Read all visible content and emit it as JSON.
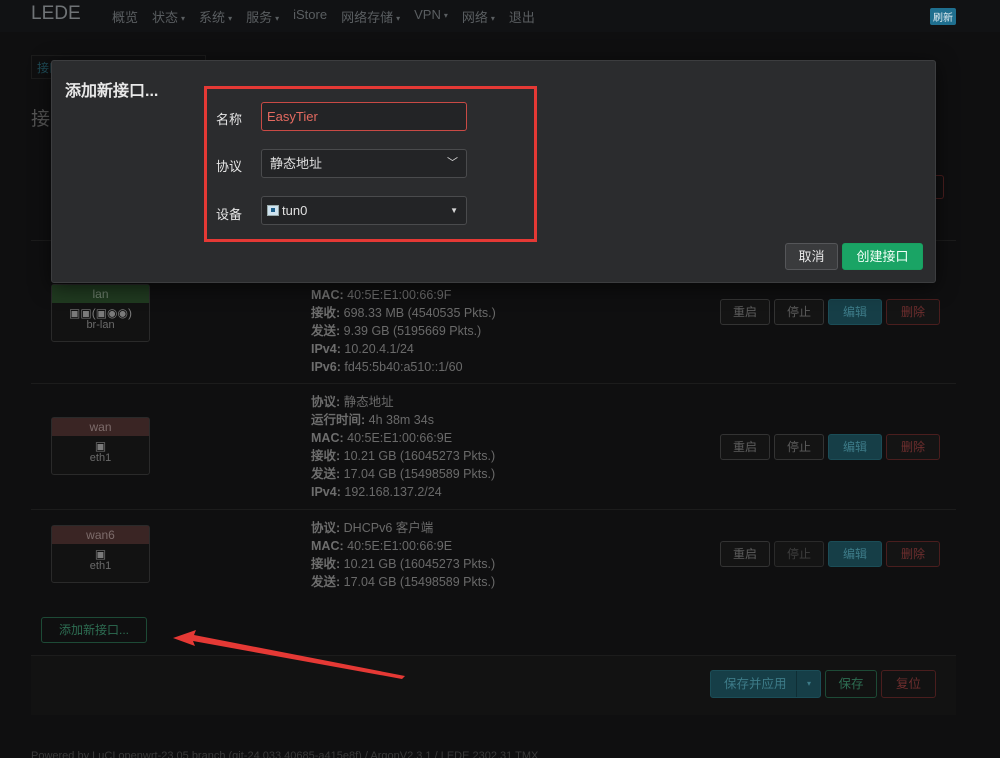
{
  "header": {
    "brand": "LEDE",
    "nav": [
      {
        "label": "概览",
        "caret": false
      },
      {
        "label": "状态",
        "caret": true
      },
      {
        "label": "系统",
        "caret": true
      },
      {
        "label": "服务",
        "caret": true
      },
      {
        "label": "iStore",
        "caret": false
      },
      {
        "label": "网络存储",
        "caret": true
      },
      {
        "label": "VPN",
        "caret": true
      },
      {
        "label": "网络",
        "caret": true
      },
      {
        "label": "退出",
        "caret": false
      }
    ],
    "badge": "刷新"
  },
  "background": {
    "tab_label": "接口",
    "section_title": "接口",
    "interfaces": [
      {
        "name": "lan",
        "icons": "(  )",
        "device": "br-lan",
        "info": [
          {
            "k": "MAC:",
            "v": " 40:5E:E1:00:66:9F"
          },
          {
            "k": "接收:",
            "v": " 698.33 MB (4540535 Pkts.)"
          },
          {
            "k": "发送:",
            "v": " 9.39 GB (5195669 Pkts.)"
          },
          {
            "k": "IPv4:",
            "v": " 10.20.4.1/24"
          },
          {
            "k": "IPv6:",
            "v": " fd45:5b40:a510::1/60"
          }
        ]
      },
      {
        "name": "wan",
        "device": "eth1",
        "info": [
          {
            "k": "协议:",
            "v": " 静态地址"
          },
          {
            "k": "运行时间:",
            "v": " 4h 38m 34s"
          },
          {
            "k": "MAC:",
            "v": " 40:5E:E1:00:66:9E"
          },
          {
            "k": "接收:",
            "v": " 10.21 GB (16045273 Pkts.)"
          },
          {
            "k": "发送:",
            "v": " 17.04 GB (15498589 Pkts.)"
          },
          {
            "k": "IPv4:",
            "v": " 192.168.137.2/24"
          }
        ]
      },
      {
        "name": "wan6",
        "device": "eth1",
        "info": [
          {
            "k": "协议:",
            "v": " DHCPv6 客户端"
          },
          {
            "k": "MAC:",
            "v": " 40:5E:E1:00:66:9E"
          },
          {
            "k": "接收:",
            "v": " 10.21 GB (16045273 Pkts.)"
          },
          {
            "k": "发送:",
            "v": " 17.04 GB (15498589 Pkts.)"
          }
        ]
      }
    ],
    "actions": {
      "restart": "重启",
      "stop": "停止",
      "edit": "编辑",
      "delete": "删除"
    },
    "add_interface": "添加新接口...",
    "save_apply": "保存并应用",
    "save": "保存",
    "reset": "复位",
    "powered_by": "Powered by LuCI openwrt-23.05 branch (git-24.033.40685-a415e8f) / ArgonV2.3.1 / LEDE 2302.31 TMX"
  },
  "modal": {
    "title": "添加新接口...",
    "name_label": "名称",
    "name_value": "EasyTier",
    "protocol_label": "协议",
    "protocol_value": "静态地址",
    "device_label": "设备",
    "device_value": "tun0",
    "cancel": "取消",
    "create": "创建接口"
  },
  "colors": {
    "highlight": "#e53935",
    "create_button": "#1aa465",
    "arrow": "#e53935"
  }
}
